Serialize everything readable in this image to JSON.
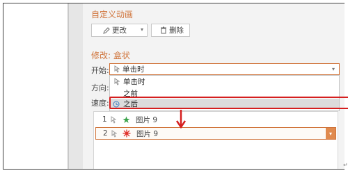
{
  "panel": {
    "title": "自定义动画",
    "change_button": "更改",
    "delete_button": "删除",
    "modify_title": "修改: 盒状"
  },
  "fields": {
    "start_label": "开始:",
    "start_value": "单击时",
    "direction_label": "方向:",
    "speed_label": "速度:"
  },
  "dropdown": {
    "items": [
      {
        "label": "单击时",
        "icon": "mouse-click-icon"
      },
      {
        "label": "之前",
        "icon": ""
      },
      {
        "label": "之后",
        "icon": "clock-icon"
      }
    ],
    "selected": "之后"
  },
  "animation_list": [
    {
      "index": "1",
      "name": "图片 9",
      "effect_icon": "green-star-icon"
    },
    {
      "index": "2",
      "name": "图片 9",
      "effect_icon": "red-burst-icon"
    }
  ],
  "colors": {
    "accent": "#d0743b",
    "highlight": "#d51f1f"
  }
}
